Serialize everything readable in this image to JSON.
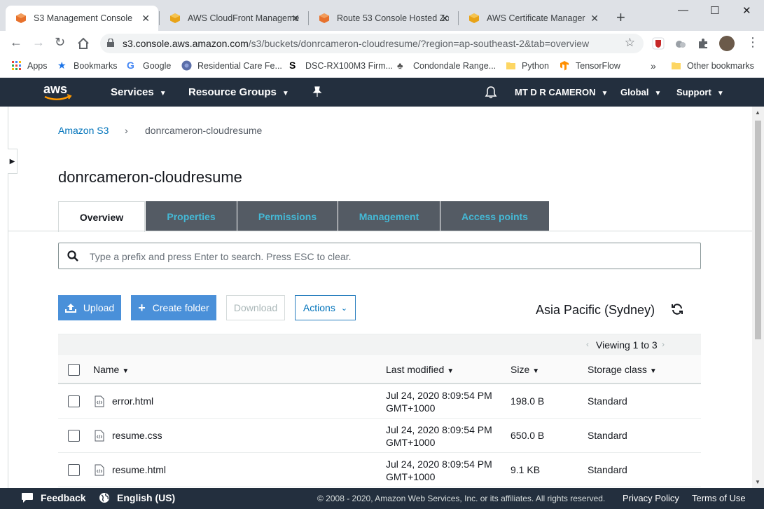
{
  "browser": {
    "tabs": [
      {
        "title": "S3 Management Console",
        "icon": "aws-s3-icon",
        "active": true
      },
      {
        "title": "AWS CloudFront Manageme",
        "icon": "aws-cloudfront-icon",
        "active": false
      },
      {
        "title": "Route 53 Console Hosted Zo",
        "icon": "aws-route53-icon",
        "active": false
      },
      {
        "title": "AWS Certificate Manager",
        "icon": "aws-acm-icon",
        "active": false
      }
    ],
    "url_host": "s3.console.aws.amazon.com",
    "url_path": "/s3/buckets/donrcameron-cloudresume/?region=ap-southeast-2&tab=overview",
    "bookmarks": [
      {
        "label": "Apps"
      },
      {
        "label": "Bookmarks"
      },
      {
        "label": "Google"
      },
      {
        "label": "Residential Care Fe..."
      },
      {
        "label": "DSC-RX100M3 Firm..."
      },
      {
        "label": "Condondale Range..."
      },
      {
        "label": "Python"
      },
      {
        "label": "TensorFlow"
      }
    ],
    "more_bookmarks": "»",
    "other_bookmarks": "Other bookmarks"
  },
  "aws_nav": {
    "services": "Services",
    "resource_groups": "Resource Groups",
    "account": "MT D R CAMERON",
    "region": "Global",
    "support": "Support"
  },
  "breadcrumb": {
    "root": "Amazon S3",
    "separator": "›",
    "current": "donrcameron-cloudresume"
  },
  "page_title": "donrcameron-cloudresume",
  "tabs": [
    {
      "label": "Overview"
    },
    {
      "label": "Properties"
    },
    {
      "label": "Permissions"
    },
    {
      "label": "Management"
    },
    {
      "label": "Access points"
    }
  ],
  "search": {
    "placeholder": "Type a prefix and press Enter to search. Press ESC to clear."
  },
  "actions": {
    "upload": "Upload",
    "create_folder": "Create folder",
    "download": "Download",
    "actions": "Actions"
  },
  "region_label": "Asia Pacific (Sydney)",
  "viewing": "Viewing 1 to 3",
  "table": {
    "headers": {
      "name": "Name",
      "modified": "Last modified",
      "size": "Size",
      "storage": "Storage class"
    },
    "rows": [
      {
        "name": "error.html",
        "modified_1": "Jul 24, 2020 8:09:54 PM",
        "modified_2": "GMT+1000",
        "size": "198.0 B",
        "storage": "Standard"
      },
      {
        "name": "resume.css",
        "modified_1": "Jul 24, 2020 8:09:54 PM",
        "modified_2": "GMT+1000",
        "size": "650.0 B",
        "storage": "Standard"
      },
      {
        "name": "resume.html",
        "modified_1": "Jul 24, 2020 8:09:54 PM",
        "modified_2": "GMT+1000",
        "size": "9.1 KB",
        "storage": "Standard"
      }
    ]
  },
  "footer": {
    "feedback": "Feedback",
    "language": "English (US)",
    "copyright": "© 2008 - 2020, Amazon Web Services, Inc. or its affiliates. All rights reserved.",
    "privacy": "Privacy Policy",
    "terms": "Terms of Use"
  },
  "colors": {
    "aws_navy": "#232f3e",
    "aws_orange": "#ff9900",
    "link_blue": "#0073bb",
    "primary_button": "#4a90d9",
    "tab_inactive_bg": "#545b64",
    "tab_inactive_text": "#44b9d6"
  }
}
